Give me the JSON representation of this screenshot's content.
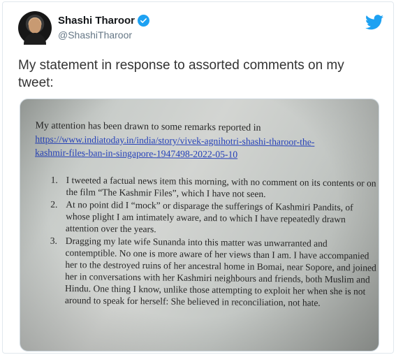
{
  "tweet": {
    "author_name": "Shashi Tharoor",
    "handle": "@ShashiTharoor",
    "text": "My statement in response to assorted comments on my tweet:"
  },
  "image": {
    "intro": "My attention has been drawn to some remarks reported in",
    "link_line1": "https://www.indiatoday.in/india/story/vivek-agnihotri-shashi-tharoor-the-",
    "link_line2": "kashmir-files-ban-in-singapore-1947498-2022-05-10",
    "items": [
      {
        "num": "1.",
        "text": "I tweeted a factual news item this morning, with no comment on its contents or on the film “The Kashmir Files”, which I have not seen."
      },
      {
        "num": "2.",
        "text": "At no point did I “mock” or disparage the sufferings of Kashmiri Pandits, of whose plight I am intimately aware, and to which I have repeatedly drawn attention over the years."
      },
      {
        "num": "3.",
        "text": "Dragging my late wife Sunanda into this matter was unwarranted and contemptible. No one is more aware of her views than I am. I have accompanied her to the destroyed ruins of her ancestral home in Bomai, near Sopore, and joined her in conversations with her Kashmiri neighbours and friends, both Muslim and Hindu. One thing I know, unlike those attempting to exploit her when she is not around to speak for herself: She believed in reconciliation, not hate."
      }
    ]
  },
  "colors": {
    "twitter_blue": "#1da1f2",
    "link_blue": "#2440b8"
  },
  "icons": [
    "verified-badge-icon",
    "twitter-bird-icon"
  ]
}
